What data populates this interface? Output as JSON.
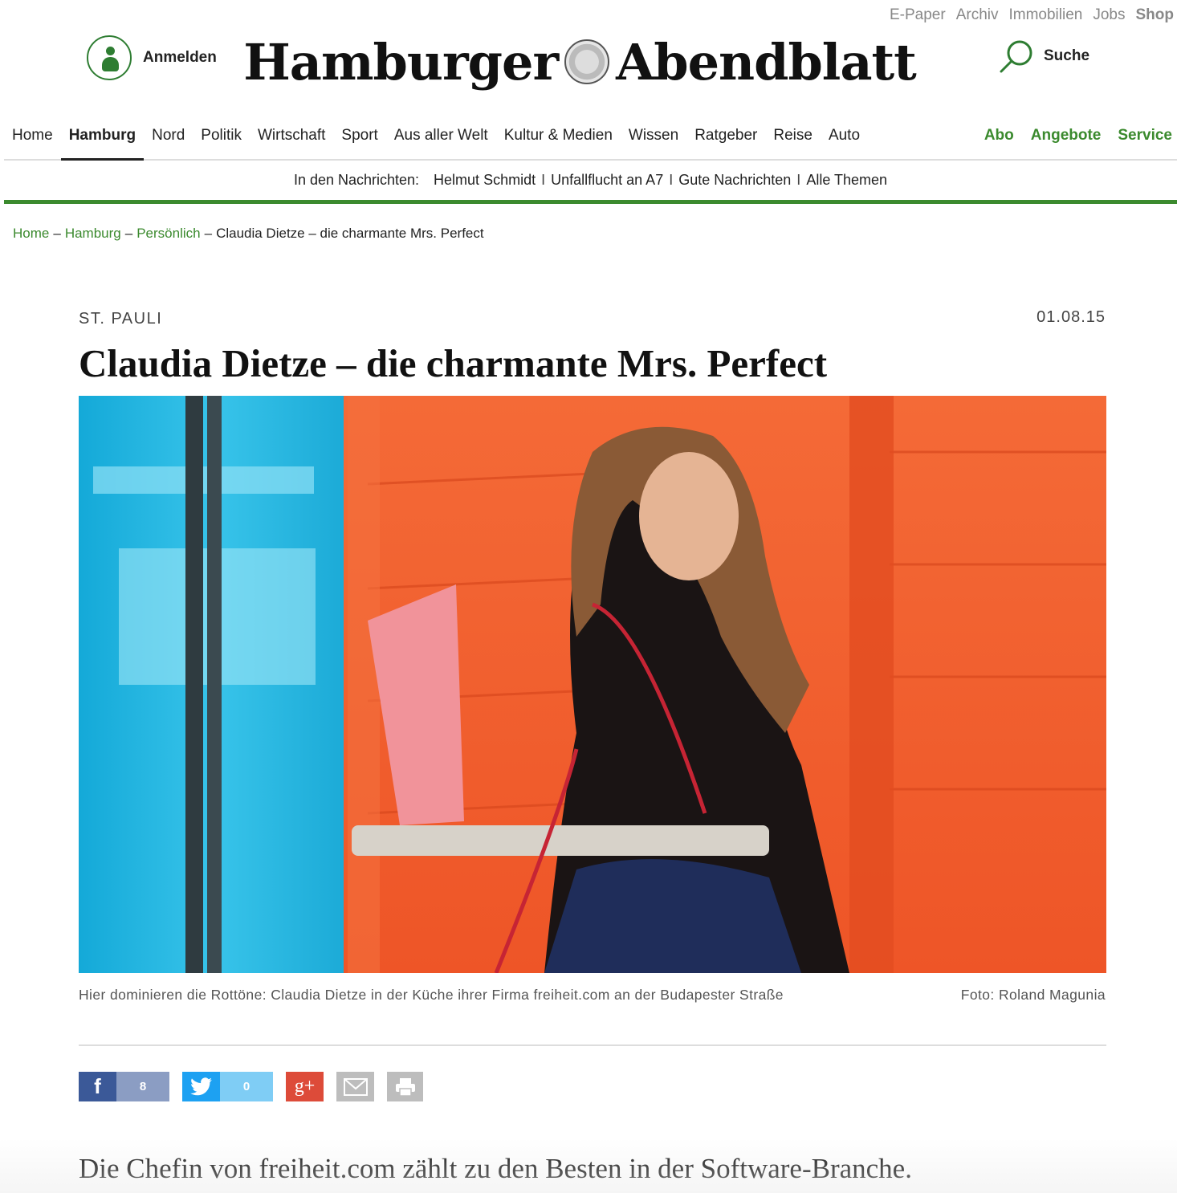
{
  "top_links": {
    "epaper": "E-Paper",
    "archiv": "Archiv",
    "immobilien": "Immobilien",
    "jobs": "Jobs",
    "shop": "Shop"
  },
  "header": {
    "login_label": "Anmelden",
    "logo_left": "Hamburger",
    "logo_right": "Abendblatt",
    "search_label": "Suche"
  },
  "nav": {
    "items": [
      "Home",
      "Hamburg",
      "Nord",
      "Politik",
      "Wirtschaft",
      "Sport",
      "Aus aller Welt",
      "Kultur & Medien",
      "Wissen",
      "Ratgeber",
      "Reise",
      "Auto"
    ],
    "active": "Hamburg",
    "right": [
      "Abo",
      "Angebote",
      "Service"
    ]
  },
  "newsbar": {
    "lead": "In den Nachrichten:",
    "links": [
      "Helmut Schmidt",
      "Unfallflucht an A7",
      "Gute Nachrichten",
      "Alle Themen"
    ],
    "separator": "I"
  },
  "breadcrumb": {
    "items": [
      "Home",
      "Hamburg",
      "Persönlich"
    ],
    "current": "Claudia Dietze – die charmante Mrs. Perfect",
    "separator": "–"
  },
  "article": {
    "kicker": "ST. PAULI",
    "date": "01.08.15",
    "headline": "Claudia Dietze – die charmante Mrs. Perfect",
    "caption": "Hier dominieren die Rottöne: Claudia Dietze in der Küche ihrer Firma freiheit.com an der Budapester Straße",
    "credit": "Foto: Roland Magunia",
    "lead": "Die Chefin von freiheit.com zählt zu den Besten in der Software-Branche."
  },
  "share": {
    "facebook_icon": "f",
    "facebook_count": "8",
    "twitter_count": "0",
    "gplus_icon": "g+"
  },
  "colors": {
    "accent_green": "#3b8a2e",
    "facebook": "#3b5998",
    "twitter": "#1da1f2",
    "gplus": "#dd4b39",
    "photo_orange": "#f05b2c",
    "photo_cyan": "#1fb4e0"
  }
}
